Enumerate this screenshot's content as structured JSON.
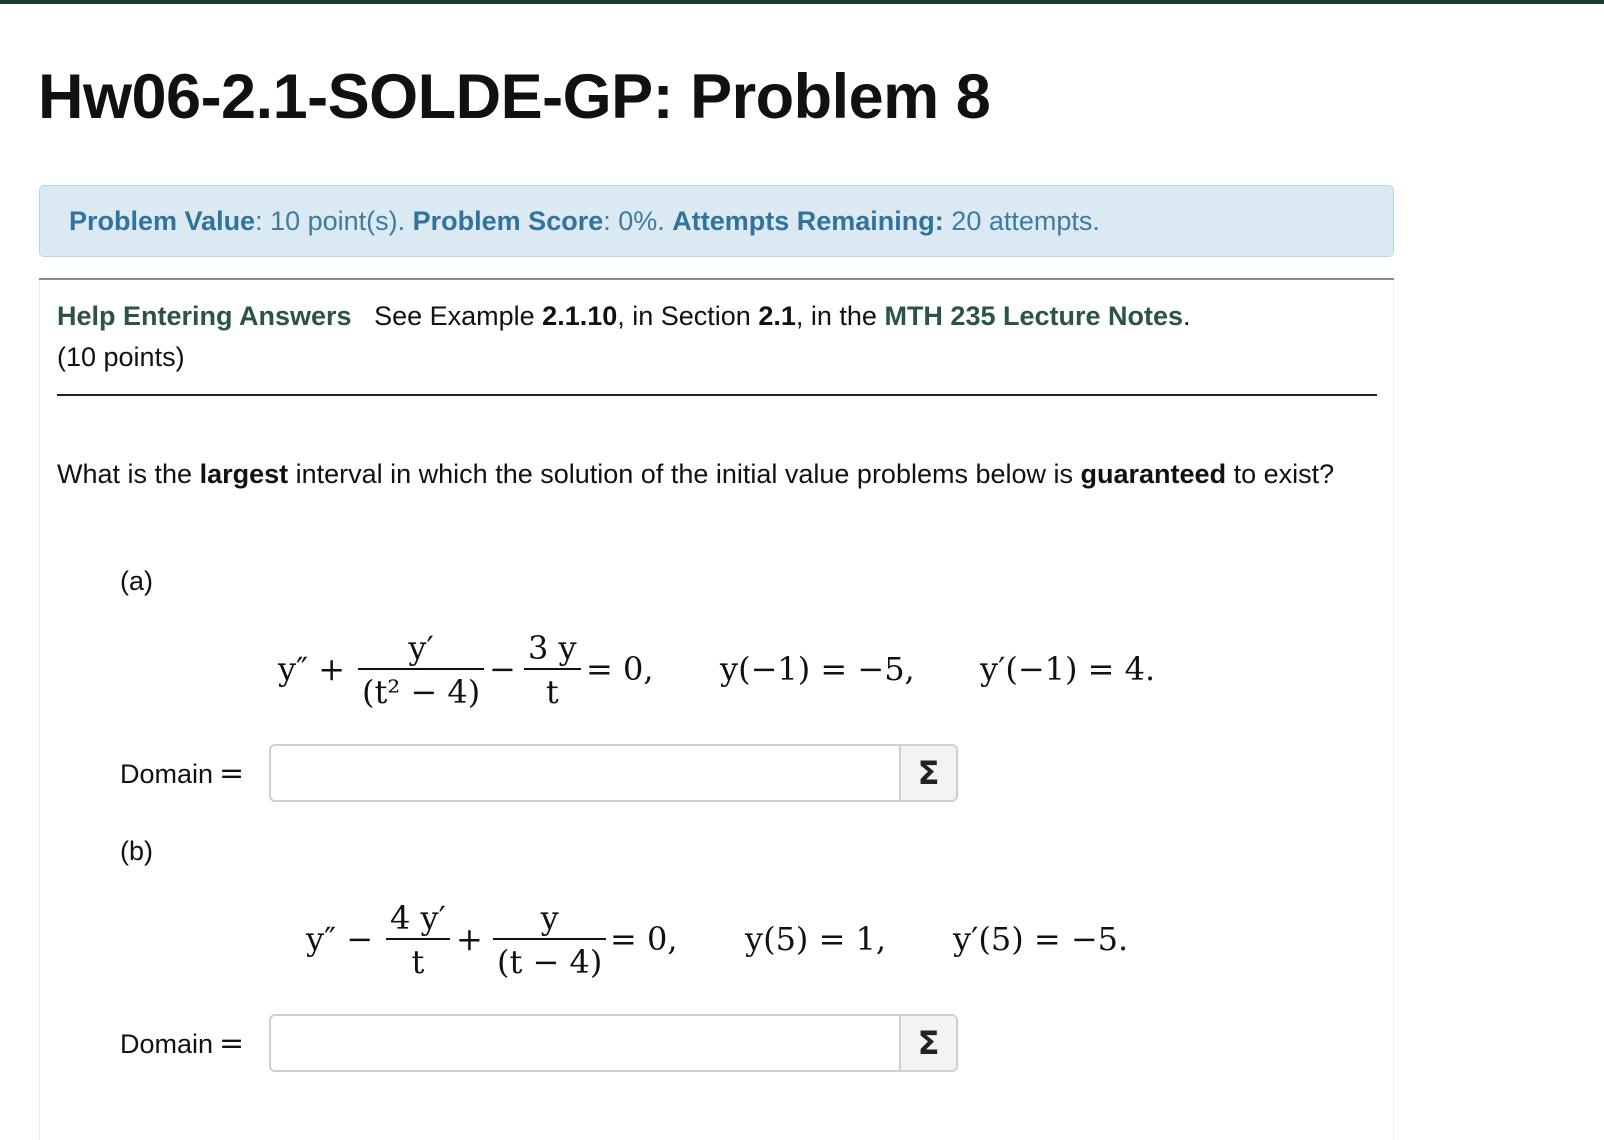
{
  "page_title": "Hw06-2.1-SOLDE-GP: Problem 8",
  "info": {
    "value_label": "Problem Value",
    "value_text": ": 10 point(s). ",
    "score_label": "Problem Score",
    "score_text": ": 0%. ",
    "attempts_label": "Attempts Remaining:",
    "attempts_text": " 20 attempts."
  },
  "help": {
    "link_label": "Help Entering Answers",
    "see_text": "See Example ",
    "example_num": "2.1.10",
    "in_section_text": ", in Section ",
    "section_num": "2.1",
    "in_the_text": ", in the ",
    "notes_link": "MTH 235 Lecture Notes",
    "period": "."
  },
  "points_text": "(10 points)",
  "question": {
    "part1": "What is the ",
    "bold1": "largest",
    "part2": " interval in which the solution of the initial value problems below is ",
    "bold2": "guaranteed",
    "part3": " to exist?"
  },
  "parts": [
    {
      "label": "(a)",
      "lhs": "y″ +",
      "frac1_num": "y′",
      "frac1_den": "(t² − 4)",
      "minus": "−",
      "frac2_num": "3 y",
      "frac2_den": "t",
      "eq_zero": "= 0,",
      "ic1": "y(−1) = −5,",
      "ic2": "y′(−1) = 4.",
      "domain_label": "Domain",
      "domain_eq": "=",
      "domain_value": ""
    },
    {
      "label": "(b)",
      "lhs": "y″ −",
      "frac1_num": "4 y′",
      "frac1_den": "t",
      "plus": "+",
      "frac2_num": "y",
      "frac2_den": "(t − 4)",
      "eq_zero": "= 0,",
      "ic1": "y(5) = 1,",
      "ic2": "y′(5) = −5.",
      "domain_label": "Domain",
      "domain_eq": "=",
      "domain_value": ""
    }
  ],
  "sigma_icon": "Σ",
  "colors": {
    "topbar": "#1f3b33",
    "info_bg": "#dbe9f2",
    "info_text": "#3f7ba0",
    "link": "#2c5446"
  }
}
